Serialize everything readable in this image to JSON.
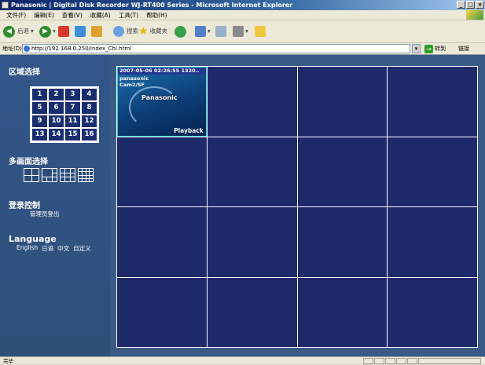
{
  "window": {
    "title": "Panasonic | Digital Disk Recorder WJ-RT400 Series - Microsoft Internet Explorer",
    "buttons": [
      "_",
      "□",
      "×"
    ]
  },
  "menubar": {
    "items": [
      "文件(F)",
      "编辑(E)",
      "查看(V)",
      "收藏(A)",
      "工具(T)",
      "帮助(H)"
    ]
  },
  "toolbar": {
    "back_label": "后退",
    "search_label": "搜索",
    "favorites_label": "收藏夹"
  },
  "addressbar": {
    "label": "地址(D)",
    "url": "http://192.168.0.250/index_Chi.html",
    "go_label": "转到",
    "links_label": "链接"
  },
  "sidebar": {
    "area_title": "区域选择",
    "area_numbers": [
      "1",
      "2",
      "3",
      "4",
      "5",
      "6",
      "7",
      "8",
      "9",
      "10",
      "11",
      "12",
      "13",
      "14",
      "15",
      "16"
    ],
    "multiscreen_title": "多画面选择",
    "login_title": "登录控制",
    "logout_label": "管理员登出",
    "language_title": "Language",
    "languages": [
      "English",
      "日语",
      "中文",
      "自定义"
    ]
  },
  "camera": {
    "timestamp": "2007-05-06 02:26:55 1320..",
    "label_line1": "panasonic",
    "label_line2": "Cam2/SF",
    "logo": "Panasonic",
    "playback_label": "Playback"
  },
  "statusbar": {
    "text": "完毕"
  },
  "colors": {
    "sidebar_bg": "#32568a",
    "grid_cell_bg": "#1f2a6a",
    "titlebar": "#0a246a"
  }
}
